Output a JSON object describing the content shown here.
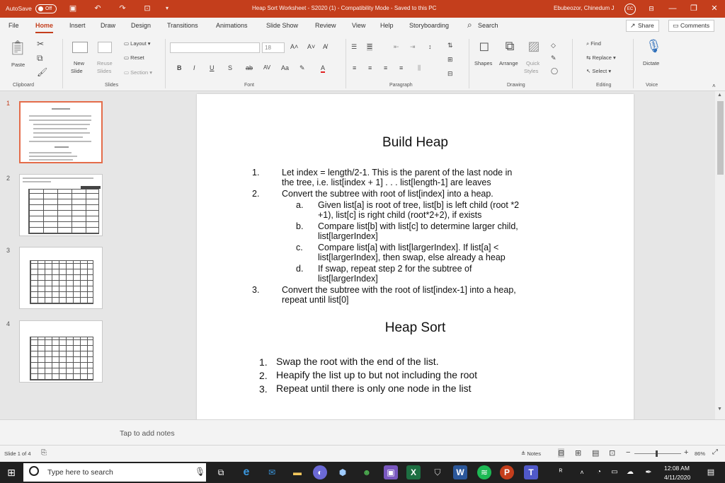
{
  "titlebar": {
    "autosave": "AutoSave",
    "toggle": "Off",
    "doc_title": "Heap Sort Worksheet - S2020 (1)  -  Compatibility Mode  -  Saved to this PC",
    "user": "Ebubeozor, Chinedum J",
    "initials": "EC"
  },
  "tabs": [
    "File",
    "Home",
    "Insert",
    "Draw",
    "Design",
    "Transitions",
    "Animations",
    "Slide Show",
    "Review",
    "View",
    "Help",
    "Storyboarding"
  ],
  "search": "Search",
  "share": "Share",
  "comments": "Comments",
  "ribbon": {
    "paste": "Paste",
    "new_slide_1": "New",
    "new_slide_2": "Slide",
    "reuse_1": "Reuse",
    "reuse_2": "Slides",
    "layout": "Layout",
    "reset": "Reset",
    "section": "Section",
    "font_size": "18",
    "shapes": "Shapes",
    "arrange": "Arrange",
    "quick_1": "Quick",
    "quick_2": "Styles",
    "find": "Find",
    "replace": "Replace",
    "select": "Select",
    "dictate": "Dictate",
    "groups": {
      "clipboard": "Clipboard",
      "slides": "Slides",
      "font": "Font",
      "paragraph": "Paragraph",
      "drawing": "Drawing",
      "editing": "Editing",
      "voice": "Voice"
    }
  },
  "thumbnails": [
    "1",
    "2",
    "3",
    "4"
  ],
  "slide": {
    "title1": "Build Heap",
    "build": [
      {
        "num": "1.",
        "text": "Let index = length/2-1.  This is the parent of the last node in"
      },
      {
        "num": "",
        "text": "the tree, i.e. list[index + 1] . . . list[length-1] are leaves"
      },
      {
        "num": "2.",
        "text": "Convert the subtree with root of list[index] into a heap."
      }
    ],
    "sub": [
      {
        "num": "a.",
        "l1": "Given list[a] is root of tree, list[b] is left child (root *2",
        "l2": "+1), list[c] is right child (root*2+2), if exists"
      },
      {
        "num": "b.",
        "l1": "Compare list[b] with list[c] to determine larger child,",
        "l2": "list[largerIndex]"
      },
      {
        "num": "c.",
        "l1": "Compare list[a] with list[largerIndex].  If list[a] <",
        "l2": "list[largerIndex], then swap, else already a heap"
      },
      {
        "num": "d.",
        "l1": "If swap, repeat step 2 for the subtree of",
        "l2": "list[largerIndex]"
      }
    ],
    "step3": {
      "num": "3.",
      "l1": "Convert the subtree with the root of list[index-1] into a heap,",
      "l2": "repeat until list[0]"
    },
    "title2": "Heap Sort",
    "sort": [
      {
        "num": "1.",
        "text": "Swap the root with the end of the list."
      },
      {
        "num": "2.",
        "text": "Heapify the list up to but not including the root"
      },
      {
        "num": "3.",
        "text": "Repeat until there is only one node in the list"
      }
    ]
  },
  "notes_placeholder": "Tap to add notes",
  "status": {
    "slide_of": "Slide 1 of 4",
    "notes": "Notes",
    "zoom": "86%"
  },
  "taskbar": {
    "search_placeholder": "Type here to search",
    "time": "12:08 AM",
    "date": "4/11/2020"
  }
}
